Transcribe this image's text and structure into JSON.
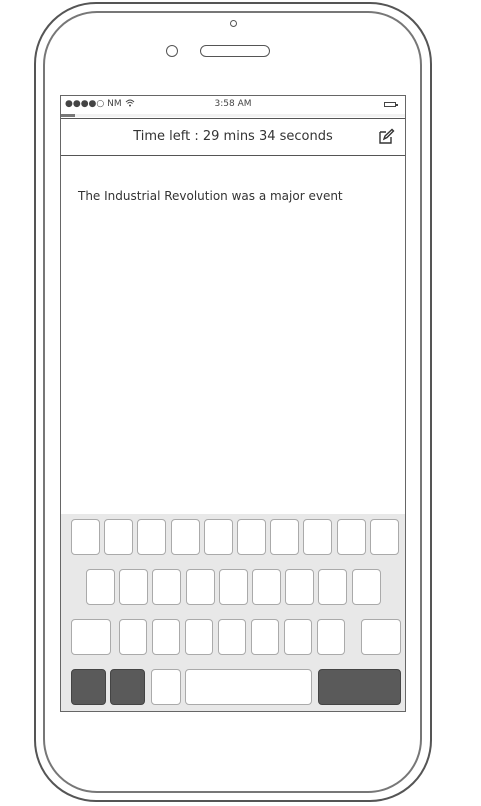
{
  "status_bar": {
    "carrier": "●●●●○ NM",
    "time": "3:58 AM"
  },
  "progress": {
    "fraction": 0.04
  },
  "header": {
    "title": "Time left : 29 mins 34 seconds",
    "edit_icon": "edit-icon"
  },
  "content": {
    "text": "The Industrial Revolution was a major event"
  },
  "keyboard": {
    "rows": [
      10,
      9,
      9,
      4
    ],
    "dark_keys": [
      "shift",
      "numbers",
      "return"
    ]
  }
}
